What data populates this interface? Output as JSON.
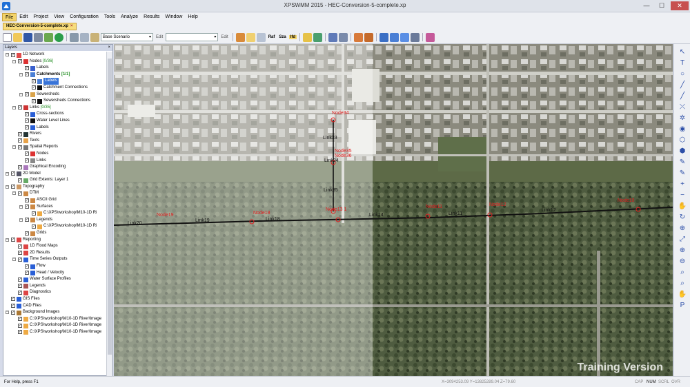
{
  "window": {
    "title": "XPSWMM 2015 - HEC-Conversion-5-complete.xp",
    "buttons": [
      "—",
      "☐",
      "✕"
    ]
  },
  "menu": [
    "File",
    "Edit",
    "Project",
    "View",
    "Configuration",
    "Tools",
    "Analyze",
    "Results",
    "Window",
    "Help"
  ],
  "document_tab": {
    "label": "HEC-Conversion-5-complete.xp",
    "close": "×"
  },
  "toolbar": {
    "scenario": "Base Scenario",
    "edit1": "Edit",
    "edit2": "Edit",
    "raf": "Raf",
    "sza": "Sza",
    "ifd": "Ifd"
  },
  "layers": {
    "header": "Layers",
    "close": "×",
    "items": [
      {
        "label": "1D Network"
      },
      {
        "label": "Nodes",
        "count": "[0/36]"
      },
      {
        "label": "Labels"
      },
      {
        "label": "Catchments",
        "count": "[1/1]"
      },
      {
        "label": "Labels"
      },
      {
        "label": "Catchment Connections"
      },
      {
        "label": "Sewersheds"
      },
      {
        "label": "Sewersheds Connections"
      },
      {
        "label": "Links",
        "count": "[0/35]"
      },
      {
        "label": "Cross-sections"
      },
      {
        "label": "Water Level Lines"
      },
      {
        "label": "Labels"
      },
      {
        "label": "Rivers"
      },
      {
        "label": "Texts"
      },
      {
        "label": "Spatial Reports"
      },
      {
        "label": "Nodes"
      },
      {
        "label": "Links"
      },
      {
        "label": "Graphical Encoding"
      },
      {
        "label": "2D Model"
      },
      {
        "label": "Grid Extents: Layer 1"
      },
      {
        "label": "Topography"
      },
      {
        "label": "DTM"
      },
      {
        "label": "ASCII Grid"
      },
      {
        "label": "Surfaces"
      },
      {
        "label": "C:\\XPS\\workshop\\M10-1D Ri"
      },
      {
        "label": "Legends"
      },
      {
        "label": "C:\\XPS\\workshop\\M10-1D Ri"
      },
      {
        "label": "Grids"
      },
      {
        "label": "Reporting"
      },
      {
        "label": "1D Flood Maps"
      },
      {
        "label": "2D Results"
      },
      {
        "label": "Time Series Outputs"
      },
      {
        "label": "Flow"
      },
      {
        "label": "Head / Velocity"
      },
      {
        "label": "Water Surface Profiles"
      },
      {
        "label": "Legends"
      },
      {
        "label": "Diagnostics"
      },
      {
        "label": "GIS Files"
      },
      {
        "label": "CAD Files"
      },
      {
        "label": "Background Images"
      },
      {
        "label": "C:\\XPS\\workshop\\M10-1D River\\Image"
      },
      {
        "label": "C:\\XPS\\workshop\\M10-1D River\\Image"
      },
      {
        "label": "C:\\XPS\\workshop\\M10-1D River\\Image"
      }
    ]
  },
  "map": {
    "labels": [
      {
        "text": "Node34",
        "kind": "node"
      },
      {
        "text": "Link33",
        "kind": "link"
      },
      {
        "text": "Node35",
        "kind": "node"
      },
      {
        "text": "Node36",
        "kind": "node"
      },
      {
        "text": "Link34",
        "kind": "link"
      },
      {
        "text": "Link35",
        "kind": "link"
      },
      {
        "text": "Node19",
        "kind": "node"
      },
      {
        "text": "Link19",
        "kind": "link"
      },
      {
        "text": "Node18",
        "kind": "node"
      },
      {
        "text": "Link18",
        "kind": "link"
      },
      {
        "text": "Node13 1",
        "kind": "node"
      },
      {
        "text": "Link14",
        "kind": "link"
      },
      {
        "text": "Node11",
        "kind": "node"
      },
      {
        "text": "Link11",
        "kind": "link"
      },
      {
        "text": "Node12",
        "kind": "node"
      },
      {
        "text": "Link12",
        "kind": "link"
      },
      {
        "text": "Node10",
        "kind": "node"
      },
      {
        "text": "Link20",
        "kind": "link"
      }
    ],
    "watermark": "Training Version"
  },
  "right_tools": [
    "↖",
    "T",
    "○",
    "╱",
    "╱",
    "⤫",
    "✲",
    "◉",
    "⬡",
    "⬢",
    "✎",
    "✎",
    "+",
    "−",
    "✋",
    "↻",
    "⊕",
    "⤢",
    "⊕",
    "⊖",
    "⌕",
    "⌕",
    "✋",
    "P"
  ],
  "status": {
    "help": "For Help, press F1",
    "coords": "X=3094253.09  Y=13825289.04  Z=79.60",
    "indicators": [
      "CAP",
      "NUM",
      "SCRL",
      "OVR"
    ]
  },
  "colors": {
    "accent": "#f3d46a",
    "node_label": "#e02020",
    "selection": "#3874d8"
  }
}
